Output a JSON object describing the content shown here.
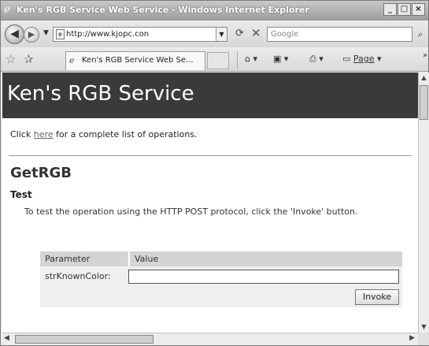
{
  "window": {
    "title": "Ken's RGB Service Web Service - Windows Internet Explorer",
    "minimize": "_",
    "maximize": "□",
    "close": "×"
  },
  "address_bar": {
    "url": "http://www.kjopc.con",
    "search_placeholder": "Google"
  },
  "tabs": [
    {
      "label": "Ken's RGB Service Web Se..."
    }
  ],
  "command_bar": {
    "page_label": "Page"
  },
  "page": {
    "banner_title": "Ken's RGB Service",
    "intro_prefix": "Click ",
    "intro_link": "here",
    "intro_suffix": " for a complete list of operations.",
    "operation_title": "GetRGB",
    "section_title": "Test",
    "description": "To test the operation using the HTTP POST protocol, click the 'Invoke' button.",
    "table": {
      "header_parameter": "Parameter",
      "header_value": "Value",
      "param_label": "strKnownColor:",
      "param_value": ""
    },
    "invoke_label": "Invoke"
  },
  "icons": {
    "ie_logo": "ie-logo-icon",
    "back": "back-arrow-icon",
    "forward": "forward-arrow-icon",
    "refresh": "refresh-icon",
    "stop": "stop-icon",
    "search": "search-icon",
    "favorites": "favorites-star-icon",
    "add_favorites": "add-favorites-icon",
    "home": "home-icon",
    "feeds": "feeds-icon",
    "print": "print-icon"
  }
}
